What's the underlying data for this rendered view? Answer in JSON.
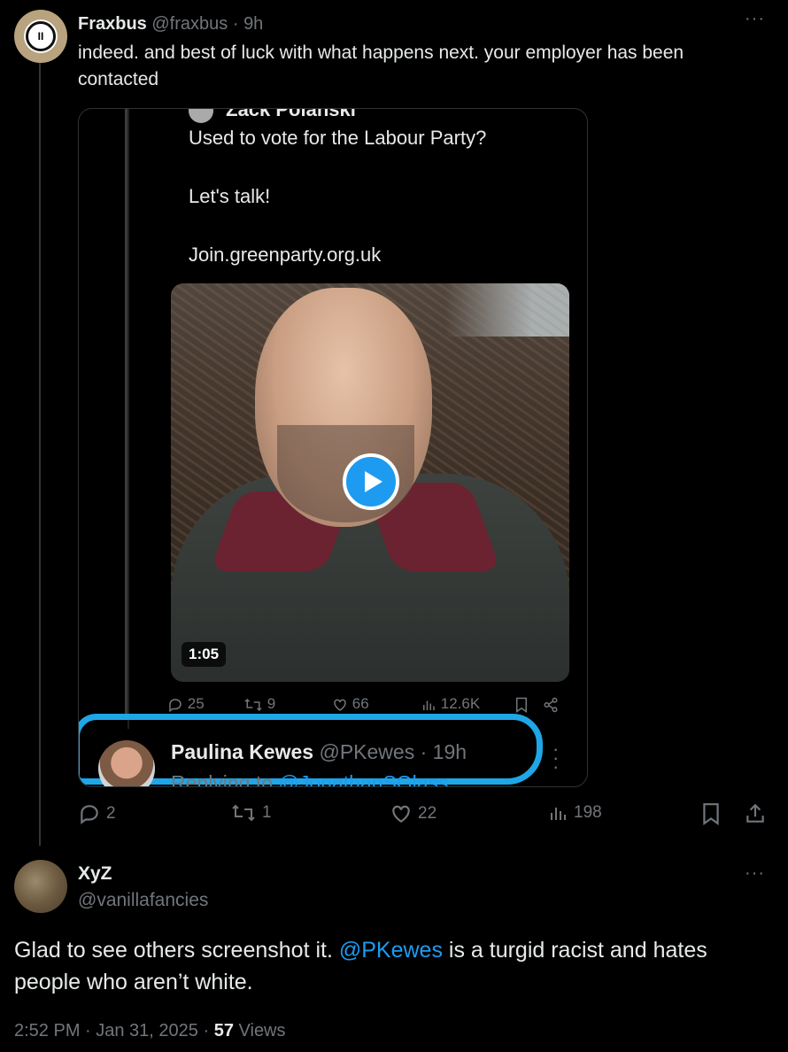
{
  "tweet1": {
    "name": "Fraxbus",
    "handle": "@fraxbus",
    "sep": "·",
    "time": "9h",
    "more": "···",
    "text": "indeed. and best of luck with what happens next. your employer has been contacted",
    "embedded": {
      "quoted_header": "Zack Polanski",
      "lines": [
        "Used to vote for the Labour Party?",
        "Let's talk!",
        "Join.greenparty.org.uk"
      ],
      "video_duration": "1:05",
      "stats": {
        "replies": "25",
        "reposts": "9",
        "likes": "66",
        "views": "12.6K"
      },
      "reply": {
        "name": "Paulina Kewes",
        "handle": "@PKewes",
        "time": "19h",
        "replying_prefix": "Replying to",
        "replying_to": "@JonathanSGlass"
      }
    },
    "stats": {
      "replies": "2",
      "reposts": "1",
      "likes": "22",
      "views": "198"
    }
  },
  "tweet2": {
    "name": "XyZ",
    "handle": "@vanillafancies",
    "more": "···",
    "text_before": "Glad to see others screenshot it. ",
    "mention": "@PKewes",
    "text_after": " is a turgid racist and hates people who aren’t white.",
    "time": "2:52 PM · Jan 31, 2025",
    "dot": " · ",
    "views_count": "57",
    "views_label": "Views"
  },
  "colors": {
    "accent": "#1d9bf0",
    "muted": "#71767b",
    "text": "#e7e9ea",
    "highlight": "#1fa6e6"
  }
}
